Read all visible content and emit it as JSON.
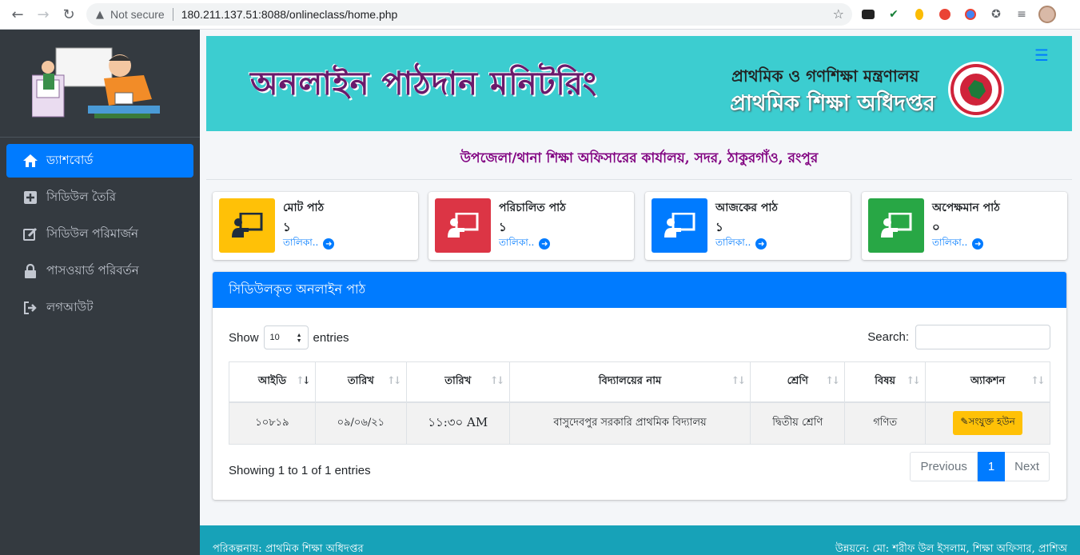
{
  "browser": {
    "security_label": "Not secure",
    "url": "180.211.137.51:8088/onlineclass/home.php"
  },
  "sidebar": {
    "items": [
      {
        "label": "ড্যাশবোর্ড",
        "icon": "home-icon",
        "active": true
      },
      {
        "label": "সিডিউল তৈরি",
        "icon": "plus-square-icon",
        "active": false
      },
      {
        "label": "সিডিউল পরিমার্জন",
        "icon": "edit-icon",
        "active": false
      },
      {
        "label": "পাসওয়ার্ড পরিবর্তন",
        "icon": "lock-icon",
        "active": false
      },
      {
        "label": "লগআউট",
        "icon": "sign-out-icon",
        "active": false
      }
    ]
  },
  "banner": {
    "title": "অনলাইন পাঠদান মনিটরিং",
    "ministry": "প্রাথমিক ও গণশিক্ষা মন্ত্রণালয়",
    "directorate": "প্রাথমিক শিক্ষা অধিদপ্তর"
  },
  "office_title": "উপজেলা/থানা শিক্ষা অফিসারের কার্যালয়, সদর, ঠাকুরগাঁও, রংপুর",
  "stats": [
    {
      "label": "মোট পাঠ",
      "value": "১",
      "link": "তালিকা..",
      "color": "#ffc107"
    },
    {
      "label": "পরিচালিত পাঠ",
      "value": "১",
      "link": "তালিকা..",
      "color": "#dc3545"
    },
    {
      "label": "আজকের পাঠ",
      "value": "১",
      "link": "তালিকা..",
      "color": "#007bff"
    },
    {
      "label": "অপেক্ষমান পাঠ",
      "value": "০",
      "link": "তালিকা..",
      "color": "#28a745"
    }
  ],
  "table_card": {
    "title": "সিডিউলকৃত অনলাইন পাঠ",
    "show_label": "Show",
    "page_length": "10",
    "entries_label": "entries",
    "search_label": "Search:",
    "columns": [
      "আইডি",
      "তারিখ",
      "তারিখ",
      "বিদ্যালয়ের নাম",
      "শ্রেণি",
      "বিষয়",
      "অ্যাকশন"
    ],
    "rows": [
      {
        "id": "১০৮১৯",
        "date": "০৯/০৬/২১",
        "time": "১১:৩০ AM",
        "school": "বাসুদেবপুর সরকারি প্রাথমিক বিদ্যালয়",
        "class": "দ্বিতীয় শ্রেণি",
        "subject": "গণিত",
        "action": "সংযুক্ত হউন"
      }
    ],
    "showing": "Showing 1 to 1 of 1 entries",
    "pager": {
      "previous": "Previous",
      "current": "1",
      "next": "Next"
    }
  },
  "footer": {
    "left": "পরিকল্পনায়: প্রাথমিক শিক্ষা অধিদপ্তর",
    "right": "উন্নয়নে: মো: শরীফ উল ইসলাম, শিক্ষা অফিসার, প্রাশিঅ"
  }
}
